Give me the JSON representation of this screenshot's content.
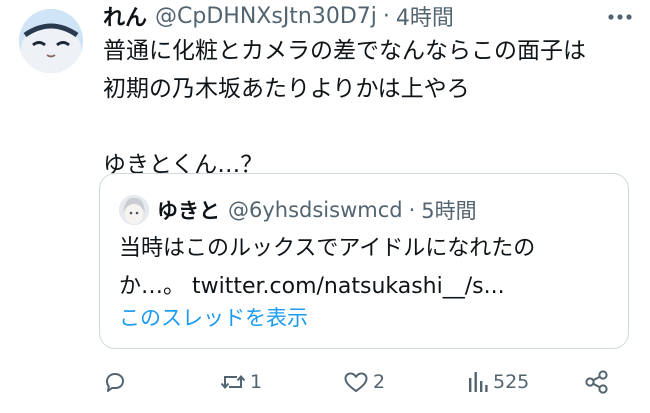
{
  "tweet": {
    "display_name": "れん",
    "handle": "@CpDHNXsJtn30D7j",
    "separator": "·",
    "time": "4時間",
    "text": "普通に化粧とカメラの差でなんならこの面子は\n初期の乃木坂あたりよりかは上やろ\n\nゆきとくん…？"
  },
  "quoted": {
    "display_name": "ゆきと",
    "handle": "@6yhsdsiswmcd",
    "separator": "·",
    "time": "5時間",
    "text": "当時はこのルックスでアイドルになれたの\nか…。 twitter.com/natsukashi__/s...",
    "show_thread": "このスレッドを表示"
  },
  "actions": {
    "reply_count": "",
    "retweet_count": "1",
    "like_count": "2",
    "views_count": "525"
  },
  "colors": {
    "text": "#0f1419",
    "secondary": "#536471",
    "link": "#1d9bf0",
    "border": "#cfd9de"
  },
  "icons": [
    "more-icon",
    "reply-icon",
    "retweet-icon",
    "like-icon",
    "views-icon",
    "share-icon"
  ]
}
